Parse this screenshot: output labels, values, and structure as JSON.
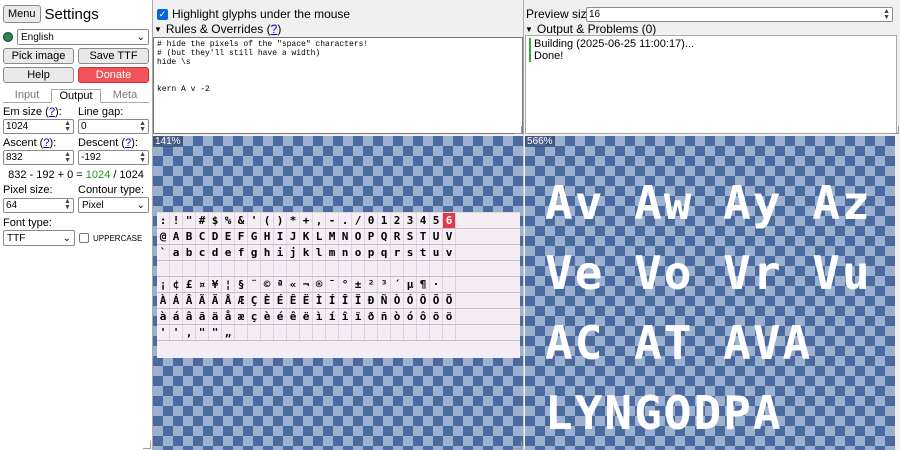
{
  "sidebar": {
    "menu_label": "Menu",
    "title": "Settings",
    "language": "English",
    "pick_image_label": "Pick image",
    "save_ttf_label": "Save TTF",
    "help_label": "Help",
    "donate_label": "Donate",
    "tabs": [
      "Input",
      "Output",
      "Meta"
    ],
    "active_tab": "Output",
    "em_size_label": "Em size (",
    "line_gap_label": "Line gap:",
    "ascent_label": "Ascent (",
    "descent_label": "Descent (",
    "q": "?",
    "em_size_value": "1024",
    "line_gap_value": "0",
    "ascent_value": "832",
    "descent_value": "-192",
    "calc_prefix": "832 - 192 + 0 =",
    "calc_result": "1024",
    "calc_suffix": "/ 1024",
    "pixel_size_label": "Pixel size:",
    "contour_type_label": "Contour type:",
    "pixel_size_value": "64",
    "contour_type_value": "Pixel",
    "font_type_label": "Font type:",
    "font_type_value": "TTF",
    "uppercase_label": "UPPERCASE"
  },
  "editor": {
    "highlight_label": "Highlight glyphs under the mouse",
    "rules_label": "Rules & Overrides (",
    "rules_text": "# hide the pixels of the \"space\" characters!\n# (but they'll still have a width)\nhide \\s\n\n\nkern A v -2"
  },
  "output": {
    "preview_size_label": "Preview size:",
    "preview_size_value": "16",
    "problems_label": "Output & Problems (0)",
    "building_text": "Building (2025-06-25 11:00:17)...",
    "done_text": "Done!"
  },
  "canvas_left": {
    "zoom": "141%",
    "rows": [
      [
        ":",
        "!",
        "\"",
        "#",
        "$",
        "%",
        "&",
        "'",
        "(",
        ")",
        "*",
        "+",
        ",",
        "-",
        ".",
        "/",
        "0",
        "1",
        "2",
        "3",
        "4",
        "5",
        "6"
      ],
      [
        "@",
        "A",
        "B",
        "C",
        "D",
        "E",
        "F",
        "G",
        "H",
        "I",
        "J",
        "K",
        "L",
        "M",
        "N",
        "O",
        "P",
        "Q",
        "R",
        "S",
        "T",
        "U",
        "V"
      ],
      [
        "`",
        "a",
        "b",
        "c",
        "d",
        "e",
        "f",
        "g",
        "h",
        "i",
        "j",
        "k",
        "l",
        "m",
        "n",
        "o",
        "p",
        "q",
        "r",
        "s",
        "t",
        "u",
        "v"
      ],
      [
        "",
        "",
        "",
        "",
        "",
        "",
        "",
        "",
        "",
        "",
        "",
        "",
        "",
        "",
        "",
        "",
        "",
        "",
        "",
        "",
        "",
        "",
        ""
      ],
      [
        "¡",
        "¢",
        "£",
        "¤",
        "¥",
        "¦",
        "§",
        "¨",
        "©",
        "ª",
        "«",
        "¬",
        "®",
        "¯",
        "°",
        "±",
        "²",
        "³",
        "´",
        "µ",
        "¶",
        "·",
        ""
      ],
      [
        "À",
        "Á",
        "Â",
        "Ã",
        "Ä",
        "Å",
        "Æ",
        "Ç",
        "È",
        "É",
        "Ê",
        "Ë",
        "Ì",
        "Í",
        "Î",
        "Ï",
        "Ð",
        "Ñ",
        "Ò",
        "Ó",
        "Ô",
        "Õ",
        "Ö"
      ],
      [
        "à",
        "á",
        "â",
        "ã",
        "ä",
        "å",
        "æ",
        "ç",
        "è",
        "é",
        "ê",
        "ë",
        "ì",
        "í",
        "î",
        "ï",
        "ð",
        "ñ",
        "ò",
        "ó",
        "ô",
        "õ",
        "ö"
      ],
      [
        "'",
        "'",
        ",",
        "\"",
        "\"",
        "„",
        "",
        "",
        "",
        "",
        "",
        "",
        "",
        "",
        "",
        "",
        "",
        "",
        "",
        "",
        "",
        "",
        ""
      ]
    ],
    "highlight_glyph": "6"
  },
  "canvas_right": {
    "zoom": "566%",
    "lines": [
      "Av Aw Ay Az",
      "Ve Vo Vr Vu",
      "AC AT AVA",
      "LYNGODPA"
    ]
  }
}
